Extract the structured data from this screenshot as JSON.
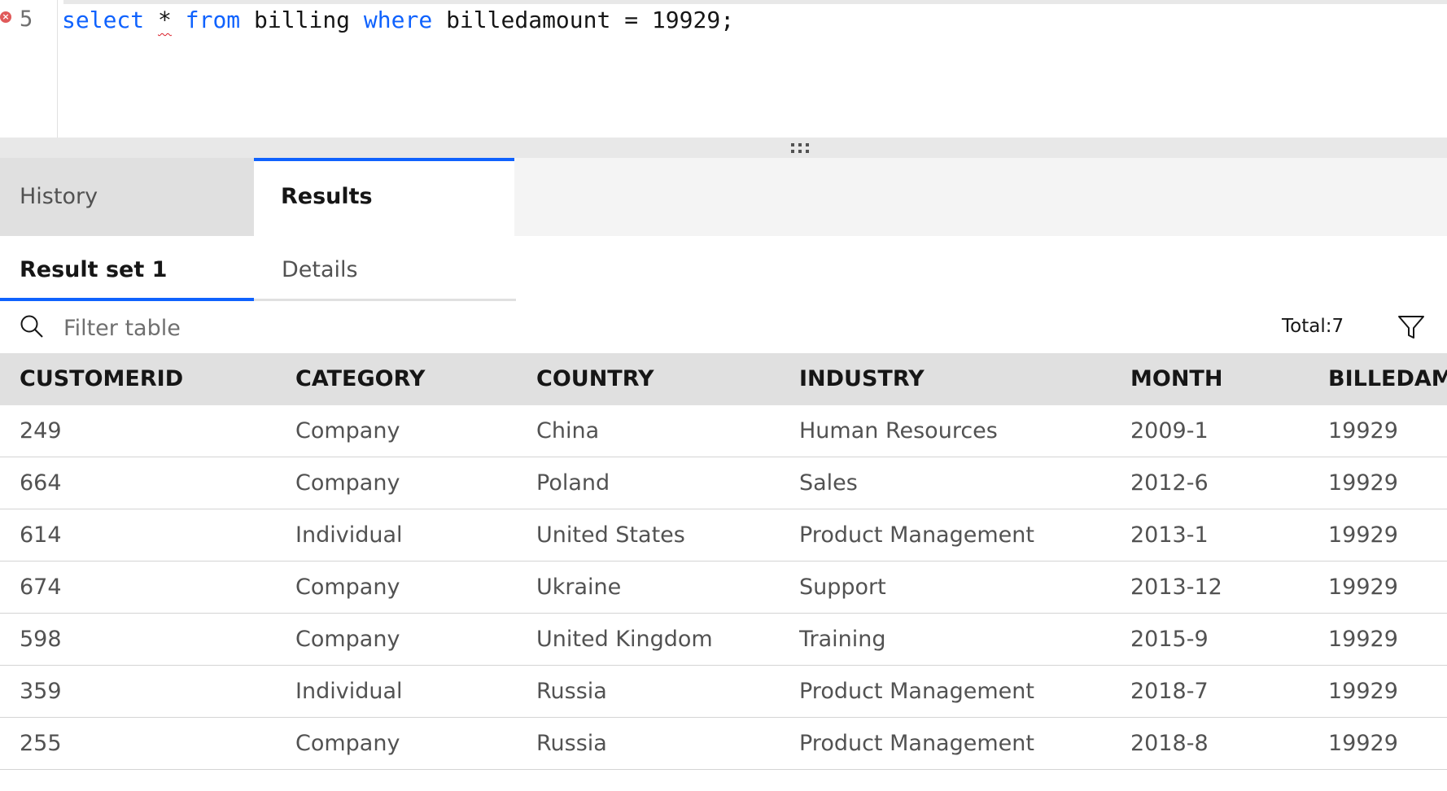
{
  "editor": {
    "line_number": "5",
    "code": {
      "select": "select",
      "star": "*",
      "from": "from",
      "table": "billing",
      "where": "where",
      "rest": "billedamount = 19929;"
    }
  },
  "tabs": {
    "history": "History",
    "results": "Results"
  },
  "subtabs": {
    "result_set": "Result set 1",
    "details": "Details"
  },
  "toolbar": {
    "filter_placeholder": "Filter table",
    "total": "Total:7"
  },
  "table": {
    "columns": [
      "CUSTOMERID",
      "CATEGORY",
      "COUNTRY",
      "INDUSTRY",
      "MONTH",
      "BILLEDAMOUNT"
    ],
    "rows": [
      [
        "249",
        "Company",
        "China",
        "Human Resources",
        "2009-1",
        "19929"
      ],
      [
        "664",
        "Company",
        "Poland",
        "Sales",
        "2012-6",
        "19929"
      ],
      [
        "614",
        "Individual",
        "United States",
        "Product Management",
        "2013-1",
        "19929"
      ],
      [
        "674",
        "Company",
        "Ukraine",
        "Support",
        "2013-12",
        "19929"
      ],
      [
        "598",
        "Company",
        "United Kingdom",
        "Training",
        "2015-9",
        "19929"
      ],
      [
        "359",
        "Individual",
        "Russia",
        "Product Management",
        "2018-7",
        "19929"
      ],
      [
        "255",
        "Company",
        "Russia",
        "Product Management",
        "2018-8",
        "19929"
      ]
    ]
  },
  "colors": {
    "accent": "#0f62fe",
    "error": "#da1e28",
    "header_bg": "#e0e0e0"
  }
}
